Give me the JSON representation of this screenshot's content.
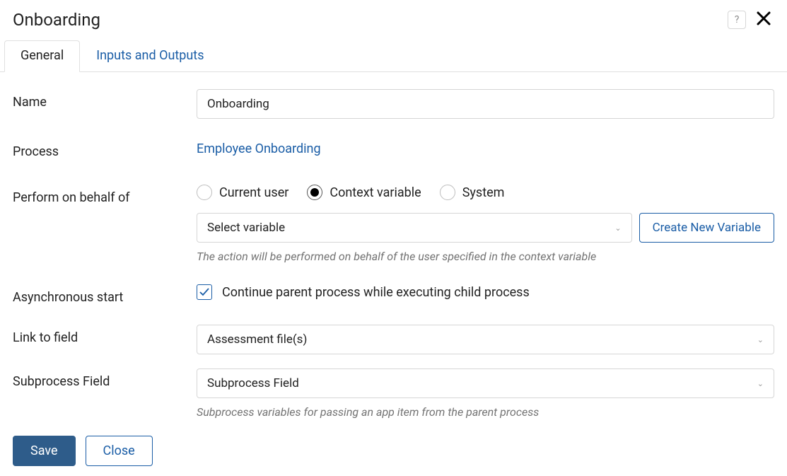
{
  "header": {
    "title": "Onboarding"
  },
  "tabs": {
    "general": "General",
    "inputs_outputs": "Inputs and Outputs"
  },
  "fields": {
    "name": {
      "label": "Name",
      "value": "Onboarding"
    },
    "process": {
      "label": "Process",
      "link_text": "Employee Onboarding"
    },
    "perform_on_behalf": {
      "label": "Perform on behalf of",
      "options": {
        "current_user": "Current user",
        "context_variable": "Context variable",
        "system": "System"
      },
      "selected": "context_variable",
      "variable_select_placeholder": "Select variable",
      "create_new_label": "Create New Variable",
      "help": "The action will be performed on behalf of the user specified in the context variable"
    },
    "async_start": {
      "label": "Asynchronous start",
      "checkbox_label": "Continue parent process while executing child process",
      "checked": true
    },
    "link_to_field": {
      "label": "Link to field",
      "value": "Assessment file(s)"
    },
    "subprocess_field": {
      "label": "Subprocess Field",
      "value": "Subprocess Field",
      "help": "Subprocess variables for passing an app item from the parent process"
    }
  },
  "footer": {
    "save": "Save",
    "close": "Close"
  }
}
